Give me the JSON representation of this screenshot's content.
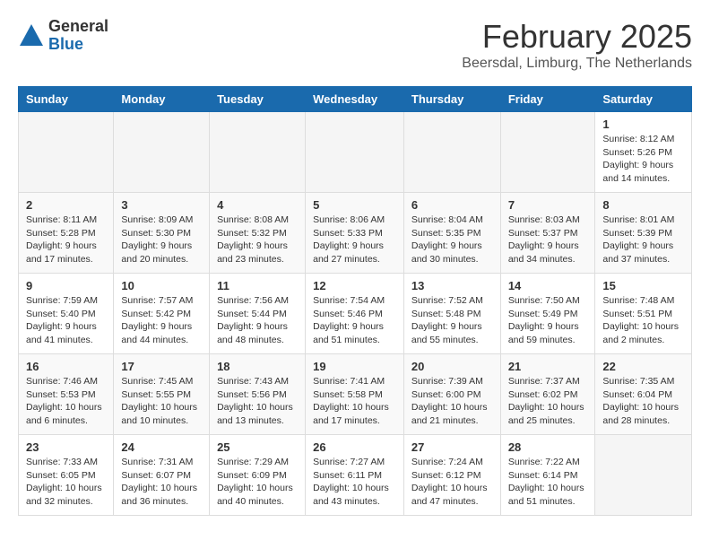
{
  "logo": {
    "general": "General",
    "blue": "Blue"
  },
  "title": "February 2025",
  "location": "Beersdal, Limburg, The Netherlands",
  "weekdays": [
    "Sunday",
    "Monday",
    "Tuesday",
    "Wednesday",
    "Thursday",
    "Friday",
    "Saturday"
  ],
  "weeks": [
    [
      {
        "day": "",
        "info": ""
      },
      {
        "day": "",
        "info": ""
      },
      {
        "day": "",
        "info": ""
      },
      {
        "day": "",
        "info": ""
      },
      {
        "day": "",
        "info": ""
      },
      {
        "day": "",
        "info": ""
      },
      {
        "day": "1",
        "info": "Sunrise: 8:12 AM\nSunset: 5:26 PM\nDaylight: 9 hours and 14 minutes."
      }
    ],
    [
      {
        "day": "2",
        "info": "Sunrise: 8:11 AM\nSunset: 5:28 PM\nDaylight: 9 hours and 17 minutes."
      },
      {
        "day": "3",
        "info": "Sunrise: 8:09 AM\nSunset: 5:30 PM\nDaylight: 9 hours and 20 minutes."
      },
      {
        "day": "4",
        "info": "Sunrise: 8:08 AM\nSunset: 5:32 PM\nDaylight: 9 hours and 23 minutes."
      },
      {
        "day": "5",
        "info": "Sunrise: 8:06 AM\nSunset: 5:33 PM\nDaylight: 9 hours and 27 minutes."
      },
      {
        "day": "6",
        "info": "Sunrise: 8:04 AM\nSunset: 5:35 PM\nDaylight: 9 hours and 30 minutes."
      },
      {
        "day": "7",
        "info": "Sunrise: 8:03 AM\nSunset: 5:37 PM\nDaylight: 9 hours and 34 minutes."
      },
      {
        "day": "8",
        "info": "Sunrise: 8:01 AM\nSunset: 5:39 PM\nDaylight: 9 hours and 37 minutes."
      }
    ],
    [
      {
        "day": "9",
        "info": "Sunrise: 7:59 AM\nSunset: 5:40 PM\nDaylight: 9 hours and 41 minutes."
      },
      {
        "day": "10",
        "info": "Sunrise: 7:57 AM\nSunset: 5:42 PM\nDaylight: 9 hours and 44 minutes."
      },
      {
        "day": "11",
        "info": "Sunrise: 7:56 AM\nSunset: 5:44 PM\nDaylight: 9 hours and 48 minutes."
      },
      {
        "day": "12",
        "info": "Sunrise: 7:54 AM\nSunset: 5:46 PM\nDaylight: 9 hours and 51 minutes."
      },
      {
        "day": "13",
        "info": "Sunrise: 7:52 AM\nSunset: 5:48 PM\nDaylight: 9 hours and 55 minutes."
      },
      {
        "day": "14",
        "info": "Sunrise: 7:50 AM\nSunset: 5:49 PM\nDaylight: 9 hours and 59 minutes."
      },
      {
        "day": "15",
        "info": "Sunrise: 7:48 AM\nSunset: 5:51 PM\nDaylight: 10 hours and 2 minutes."
      }
    ],
    [
      {
        "day": "16",
        "info": "Sunrise: 7:46 AM\nSunset: 5:53 PM\nDaylight: 10 hours and 6 minutes."
      },
      {
        "day": "17",
        "info": "Sunrise: 7:45 AM\nSunset: 5:55 PM\nDaylight: 10 hours and 10 minutes."
      },
      {
        "day": "18",
        "info": "Sunrise: 7:43 AM\nSunset: 5:56 PM\nDaylight: 10 hours and 13 minutes."
      },
      {
        "day": "19",
        "info": "Sunrise: 7:41 AM\nSunset: 5:58 PM\nDaylight: 10 hours and 17 minutes."
      },
      {
        "day": "20",
        "info": "Sunrise: 7:39 AM\nSunset: 6:00 PM\nDaylight: 10 hours and 21 minutes."
      },
      {
        "day": "21",
        "info": "Sunrise: 7:37 AM\nSunset: 6:02 PM\nDaylight: 10 hours and 25 minutes."
      },
      {
        "day": "22",
        "info": "Sunrise: 7:35 AM\nSunset: 6:04 PM\nDaylight: 10 hours and 28 minutes."
      }
    ],
    [
      {
        "day": "23",
        "info": "Sunrise: 7:33 AM\nSunset: 6:05 PM\nDaylight: 10 hours and 32 minutes."
      },
      {
        "day": "24",
        "info": "Sunrise: 7:31 AM\nSunset: 6:07 PM\nDaylight: 10 hours and 36 minutes."
      },
      {
        "day": "25",
        "info": "Sunrise: 7:29 AM\nSunset: 6:09 PM\nDaylight: 10 hours and 40 minutes."
      },
      {
        "day": "26",
        "info": "Sunrise: 7:27 AM\nSunset: 6:11 PM\nDaylight: 10 hours and 43 minutes."
      },
      {
        "day": "27",
        "info": "Sunrise: 7:24 AM\nSunset: 6:12 PM\nDaylight: 10 hours and 47 minutes."
      },
      {
        "day": "28",
        "info": "Sunrise: 7:22 AM\nSunset: 6:14 PM\nDaylight: 10 hours and 51 minutes."
      },
      {
        "day": "",
        "info": ""
      }
    ]
  ]
}
